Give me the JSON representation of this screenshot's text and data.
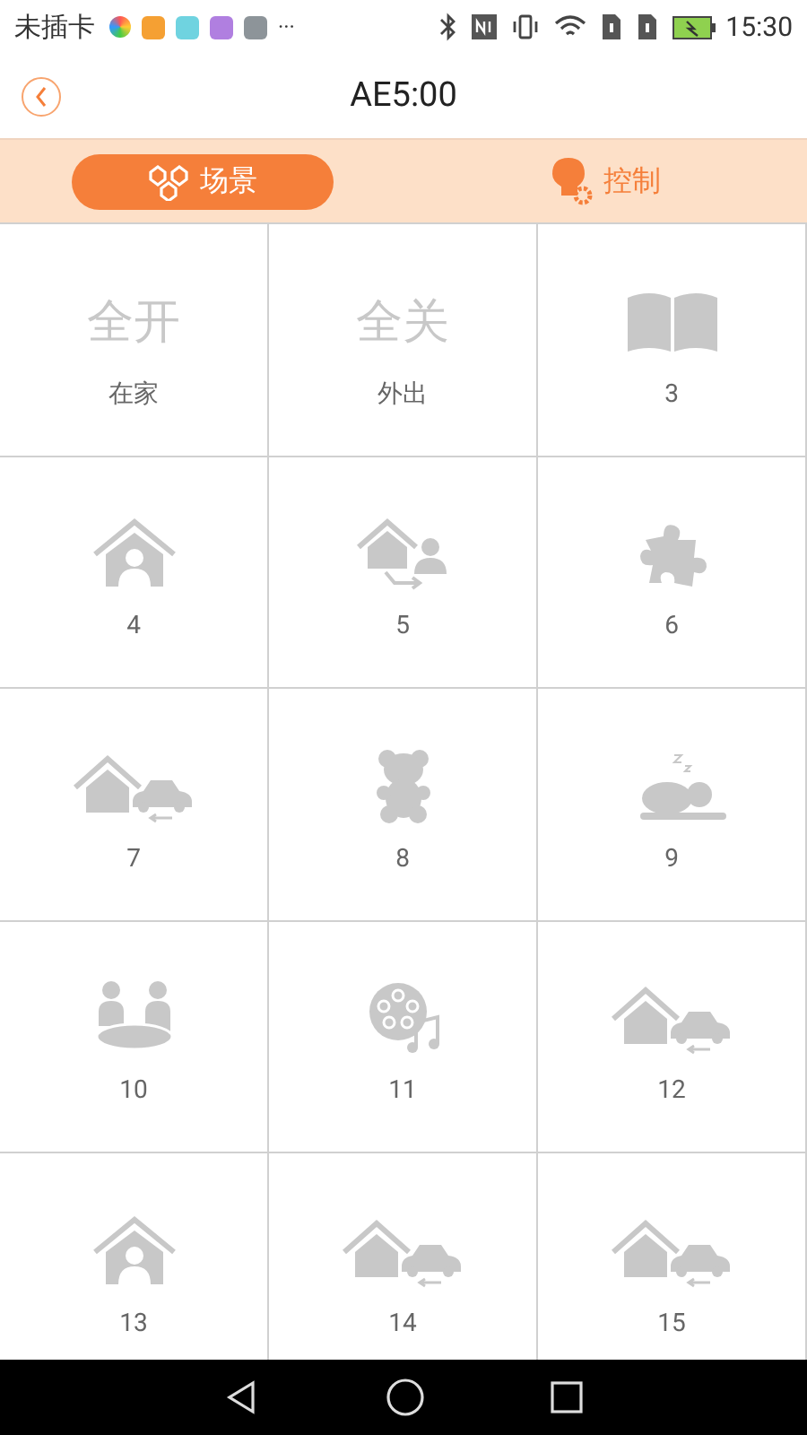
{
  "status_bar": {
    "carrier": "未插卡",
    "overflow": "···",
    "time": "15:30"
  },
  "header": {
    "title": "AE5:00"
  },
  "tabs": [
    {
      "label": "场景",
      "selected": true
    },
    {
      "label": "控制",
      "selected": false
    }
  ],
  "scenes": [
    {
      "kind": "text",
      "icon_text": "全开",
      "label": "在家"
    },
    {
      "kind": "text",
      "icon_text": "全关",
      "label": "外出"
    },
    {
      "kind": "book",
      "label": "3"
    },
    {
      "kind": "houseperson",
      "label": "4"
    },
    {
      "kind": "leavehome",
      "label": "5"
    },
    {
      "kind": "puzzle",
      "label": "6"
    },
    {
      "kind": "housecar",
      "label": "7"
    },
    {
      "kind": "bear",
      "label": "8"
    },
    {
      "kind": "sleep",
      "label": "9"
    },
    {
      "kind": "meeting",
      "label": "10"
    },
    {
      "kind": "film",
      "label": "11"
    },
    {
      "kind": "housecar",
      "label": "12"
    },
    {
      "kind": "houseperson",
      "label": "13"
    },
    {
      "kind": "housecar",
      "label": "14"
    },
    {
      "kind": "housecar",
      "label": "15"
    }
  ]
}
